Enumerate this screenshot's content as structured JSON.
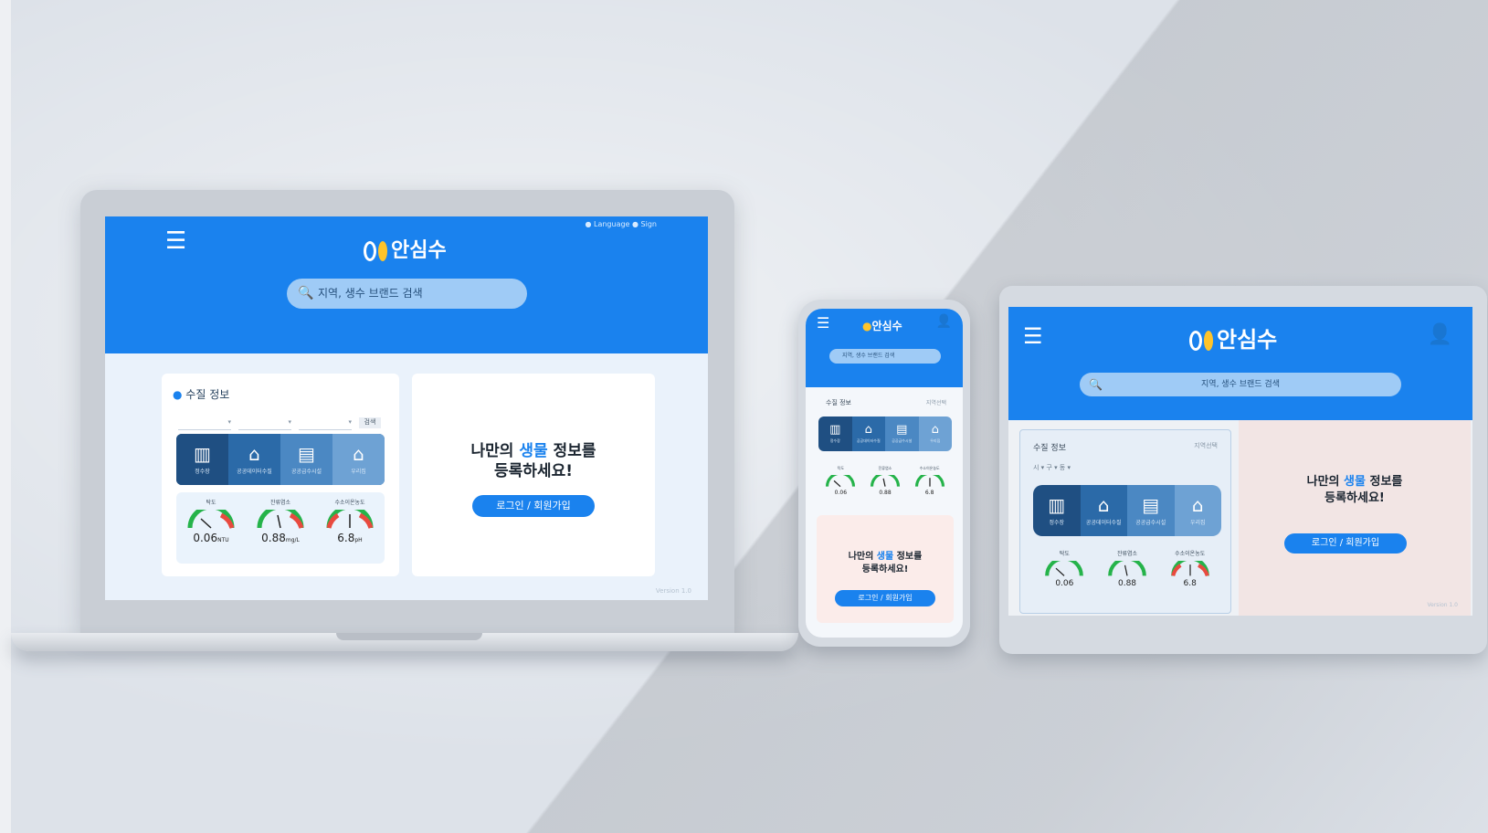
{
  "app": {
    "brand_name": "안심수",
    "brand_color": "#1a82ee",
    "accent_color": "#ffc42a"
  },
  "laptop": {
    "header": {
      "menu_icon": "hamburger-icon",
      "top_links": "● Language  ● Sign",
      "search_placeholder": "지역, 생수 브랜드 검색",
      "search_icon": "search-icon"
    },
    "water_info": {
      "title": "수질 정보",
      "select_button": "검색",
      "categories": [
        {
          "icon": "filter-icon",
          "label": "정수장"
        },
        {
          "icon": "house-icon",
          "label": "공공데이터수질"
        },
        {
          "icon": "building-icon",
          "label": "공공급수시설"
        },
        {
          "icon": "home-icon",
          "label": "우리집"
        }
      ],
      "gauges": [
        {
          "label": "탁도",
          "value": "0.06",
          "unit": "NTU"
        },
        {
          "label": "잔류염소",
          "value": "0.88",
          "unit": "mg/L"
        },
        {
          "label": "수소이온농도",
          "value": "6.8",
          "unit": "pH"
        }
      ]
    },
    "promo": {
      "line1_pre": "나만의 ",
      "line1_highlight": "생물",
      "line1_post": " 정보를",
      "line2": "등록하세요!",
      "login_button": "로그인 / 회원가입"
    },
    "footer": "Version 1.0"
  },
  "phone": {
    "menu_icon": "hamburger-icon",
    "user_icon": "user-icon",
    "search_placeholder": "지역, 생수 브랜드 검색",
    "title": "수질 정보",
    "title_right": "지역선택",
    "categories": [
      "정수장",
      "공공데이터수질",
      "공공급수시설",
      "우리집"
    ],
    "gauges": [
      {
        "label": "탁도",
        "value": "0.06",
        "unit": "NTU"
      },
      {
        "label": "잔류염소",
        "value": "0.88",
        "unit": "mg/L"
      },
      {
        "label": "수소이온농도",
        "value": "6.8",
        "unit": "pH"
      }
    ],
    "promo": {
      "line1_pre": "나만의 ",
      "line1_highlight": "생물",
      "line1_post": " 정보를",
      "line2": "등록하세요!",
      "login_button": "로그인 / 회원가입"
    }
  },
  "tablet": {
    "menu_icon": "hamburger-icon",
    "user_icon": "user-icon",
    "search_placeholder": "지역, 생수 브랜드 검색",
    "title": "수질 정보",
    "title_right": "지역선택",
    "selects": "시 ▾   구 ▾   동 ▾",
    "categories": [
      "정수장",
      "공공데이터수질",
      "공공급수시설",
      "우리집"
    ],
    "gauges": [
      {
        "label": "탁도",
        "value": "0.06",
        "unit": "NTU"
      },
      {
        "label": "잔류염소",
        "value": "0.88",
        "unit": "mg/L"
      },
      {
        "label": "수소이온농도",
        "value": "6.8",
        "unit": "pH"
      }
    ],
    "promo": {
      "line1_pre": "나만의 ",
      "line1_highlight": "생물",
      "line1_post": " 정보를",
      "line2": "등록하세요!",
      "login_button": "로그인 / 회원가입"
    },
    "footer": "Version 1.0"
  }
}
